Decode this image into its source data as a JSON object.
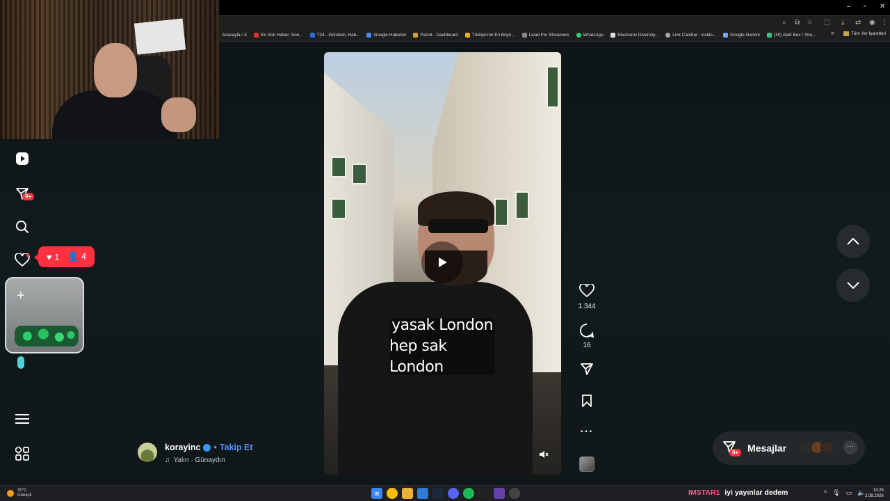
{
  "bookmarks": [
    {
      "label": "Anasayfa / X"
    },
    {
      "label": "En Son Haber: Son..."
    },
    {
      "label": "T24 - Gündem, Hab..."
    },
    {
      "label": "Google Haberler"
    },
    {
      "label": "Parrot - Dashboard"
    },
    {
      "label": "Türkiye'nin En Büyü..."
    },
    {
      "label": "Livad For Streamers"
    },
    {
      "label": "WhatsApp"
    },
    {
      "label": "Electronic Diversity..."
    },
    {
      "label": "Link Catcher - kicklo..."
    },
    {
      "label": "Google Gemini"
    },
    {
      "label": "(19) Alert Box / Stre..."
    }
  ],
  "bookmarks_more": "»",
  "bookmarks_all": "Tüm Yer İşaretleri",
  "sidebar": {
    "messages_badge": "9+",
    "notif_likes": "1",
    "notif_follows": "4"
  },
  "video": {
    "caption_line1": "yasak London",
    "caption_line2": "hep sak London"
  },
  "actions": {
    "likes": "1.344",
    "comments": "16"
  },
  "author": {
    "username": "korayinc",
    "separator": "•",
    "follow_label": "Takip Et",
    "song": "Yalın · Günaydın"
  },
  "messages": {
    "label": "Mesajlar",
    "badge": "9+",
    "more": "···"
  },
  "taskbar": {
    "temp": "30°C",
    "weather": "Güneşli",
    "chat_user": "IMSTAR1",
    "chat_message": "iyi yayınlar dedem",
    "time": "13:29",
    "date": "2.08.2026"
  },
  "colors": {
    "accent_red": "#ff3040",
    "follow_blue": "#5a8dff",
    "background": "#0f1416"
  }
}
